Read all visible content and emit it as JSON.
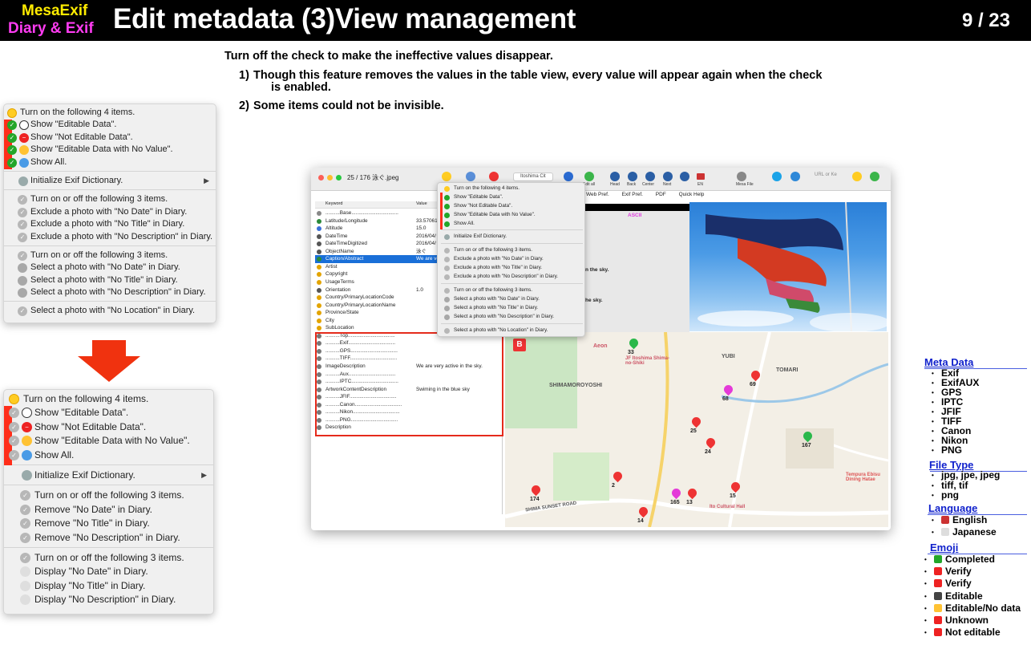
{
  "header": {
    "app_name_line1": "MesaExif",
    "app_name_line2": "Diary & Exif",
    "title": "Edit metadata (3)View management",
    "page": "9 / 23"
  },
  "intro": "Turn off the check to make the ineffective values disappear.",
  "notes": [
    {
      "num": "1)",
      "text": "Though this feature removes the values in the table view, every value will appear again when the check",
      "cont": "is enabled."
    },
    {
      "num": "2)",
      "text": "Some items could not be invisible."
    }
  ],
  "menu_top": {
    "group1_header": "Turn on the following 4 items.",
    "group1": [
      "Show \"Editable Data\".",
      "Show \"Not Editable Data\".",
      "Show \"Editable Data with No Value\".",
      "Show All."
    ],
    "init": "Initialize Exif Dictionary.",
    "group2_header": "Turn on or off the following 3 items.",
    "group2": [
      "Exclude a photo with \"No Date\" in Diary.",
      "Exclude a photo with \"No Title\" in Diary.",
      "Exclude a photo with \"No Description\" in Diary."
    ],
    "group3_header": "Turn on or off the following 3 items.",
    "group3": [
      "Select a photo with \"No Date\" in Diary.",
      "Select a photo with \"No Title\" in Diary.",
      "Select a photo with \"No Description\" in Diary."
    ],
    "location": "Select a photo with \"No Location\" in Diary."
  },
  "menu_bottom": {
    "group1_header": "Turn on the following 4 items.",
    "group1": [
      "Show \"Editable Data\".",
      "Show \"Not Editable Data\".",
      "Show \"Editable Data with No Value\".",
      "Show All."
    ],
    "init": "Initialize Exif Dictionary.",
    "group2_header": "Turn on or off the following 3 items.",
    "group2": [
      "Remove \"No Date\" in Diary.",
      "Remove \"No Title\" in Diary.",
      "Remove \"No Description\" in Diary."
    ],
    "group3_header": "Turn on or off the following 3 items.",
    "group3": [
      "Display \"No Date\" in Diary.",
      "Display \"No Title\" in Diary.",
      "Display \"No Description\" in Diary."
    ]
  },
  "window": {
    "title": "25 / 176 泳ぐ.jpeg",
    "search": "Itoshima Cit",
    "url_placeholder": "URL or Ke",
    "toolbar_labels": [
      "Edit all",
      "Head",
      "Back",
      "Center",
      "Next",
      "EN",
      "Mesa File"
    ],
    "subbar": [
      "Web Pref.",
      "Exif Pref.",
      "PDF",
      "Quick Help"
    ],
    "table_headers": [
      "Keyword",
      "Value"
    ],
    "rows": [
      {
        "k": "..........Base.................................",
        "v": ""
      },
      {
        "k": "Latitude/Longitude",
        "v": "33.57061"
      },
      {
        "k": "Altitude",
        "v": "15.0"
      },
      {
        "k": "DateTime",
        "v": "2016/04/"
      },
      {
        "k": "DateTimeDigitized",
        "v": "2016/04/"
      },
      {
        "k": "ObjectName",
        "v": "泳ぐ"
      },
      {
        "k": "Caption/Abstract",
        "v": "We are ve"
      },
      {
        "k": "Artist",
        "v": ""
      },
      {
        "k": "Copyright",
        "v": ""
      },
      {
        "k": "UsageTerms",
        "v": ""
      },
      {
        "k": "Orientation",
        "v": "1.0"
      },
      {
        "k": "Country/PrimaryLocationCode",
        "v": ""
      },
      {
        "k": "Country/PrimaryLocationName",
        "v": ""
      },
      {
        "k": "Province/State",
        "v": ""
      },
      {
        "k": "City",
        "v": ""
      },
      {
        "k": "SubLocation",
        "v": ""
      },
      {
        "k": "..........Top.................................",
        "v": ""
      },
      {
        "k": "..........Exif.................................",
        "v": ""
      },
      {
        "k": "..........GPS.................................",
        "v": ""
      },
      {
        "k": "..........TIFF.................................",
        "v": ""
      },
      {
        "k": "ImageDescription",
        "v": "We are very active in the sky."
      },
      {
        "k": "..........Aux.................................",
        "v": ""
      },
      {
        "k": "..........IPTC.................................",
        "v": ""
      },
      {
        "k": "ArtworkContentDescription",
        "v": "Swiming in the blue sky"
      },
      {
        "k": "..........JFIF.................................",
        "v": ""
      },
      {
        "k": "..........Canon.................................",
        "v": ""
      },
      {
        "k": "..........Nikon.................................",
        "v": ""
      },
      {
        "k": "..........PNG.................................",
        "v": ""
      },
      {
        "k": "Description",
        "v": ""
      }
    ],
    "popup": [
      "Turn on the following 4 items.",
      "Show \"Editable Data\".",
      "Show \"Not Editable Data\".",
      "Show \"Editable Data with No Value\".",
      "Show All.",
      "Initialize Exif Dictionary.",
      "Turn on or off the following 3 items.",
      "Exclude a photo with \"No Date\" in Diary.",
      "Exclude a photo with \"No Title\" in Diary.",
      "Exclude a photo with \"No Description\" in Diary.",
      "Turn on or off the following 3 items.",
      "Select a photo with \"No Date\" in Diary.",
      "Select a photo with \"No Title\" in Diary.",
      "Select a photo with \"No Description\" in Diary.",
      "Select a photo with \"No Location\" in Diary."
    ],
    "ascii_label": "ASCII",
    "sky1": "n the sky.",
    "sky2": "he sky.",
    "map_labels": [
      "Aeon",
      "JF Itoshima Shima-no-Shiki",
      "YUBI",
      "TOMARI",
      "SHIMAMOROYOSHI",
      "SHIMA SUNSET ROAD",
      "Tempura Ebisu Dining Hatae",
      "Ito Cultural Hall"
    ],
    "pins": [
      "33",
      "69",
      "68",
      "167",
      "25",
      "24",
      "174",
      "2",
      "165",
      "13",
      "15",
      "14"
    ],
    "map_badge": "B"
  },
  "legend": {
    "meta_head": "Meta Data",
    "meta_items": [
      "Exif",
      "ExifAUX",
      "GPS",
      "IPTC",
      "JFIF",
      "TIFF",
      "Canon",
      "Nikon",
      "PNG"
    ],
    "file_head": "File Type",
    "file_items": [
      "jpg, jpe, jpeg",
      "tiff, tif",
      "png"
    ],
    "lang_head": "Language",
    "lang_items": [
      "English",
      "Japanese"
    ],
    "emoji_head": "Emoji",
    "emoji_items": [
      "Completed",
      "Verify",
      "Verify",
      "Editable",
      "Editable/No data",
      "Unknown",
      "Not editable"
    ]
  },
  "colors": {
    "accent_red": "#ff2e1a",
    "app_yellow": "#ffec00",
    "app_magenta": "#ff3cf2",
    "legend_blue": "#1122cc"
  }
}
